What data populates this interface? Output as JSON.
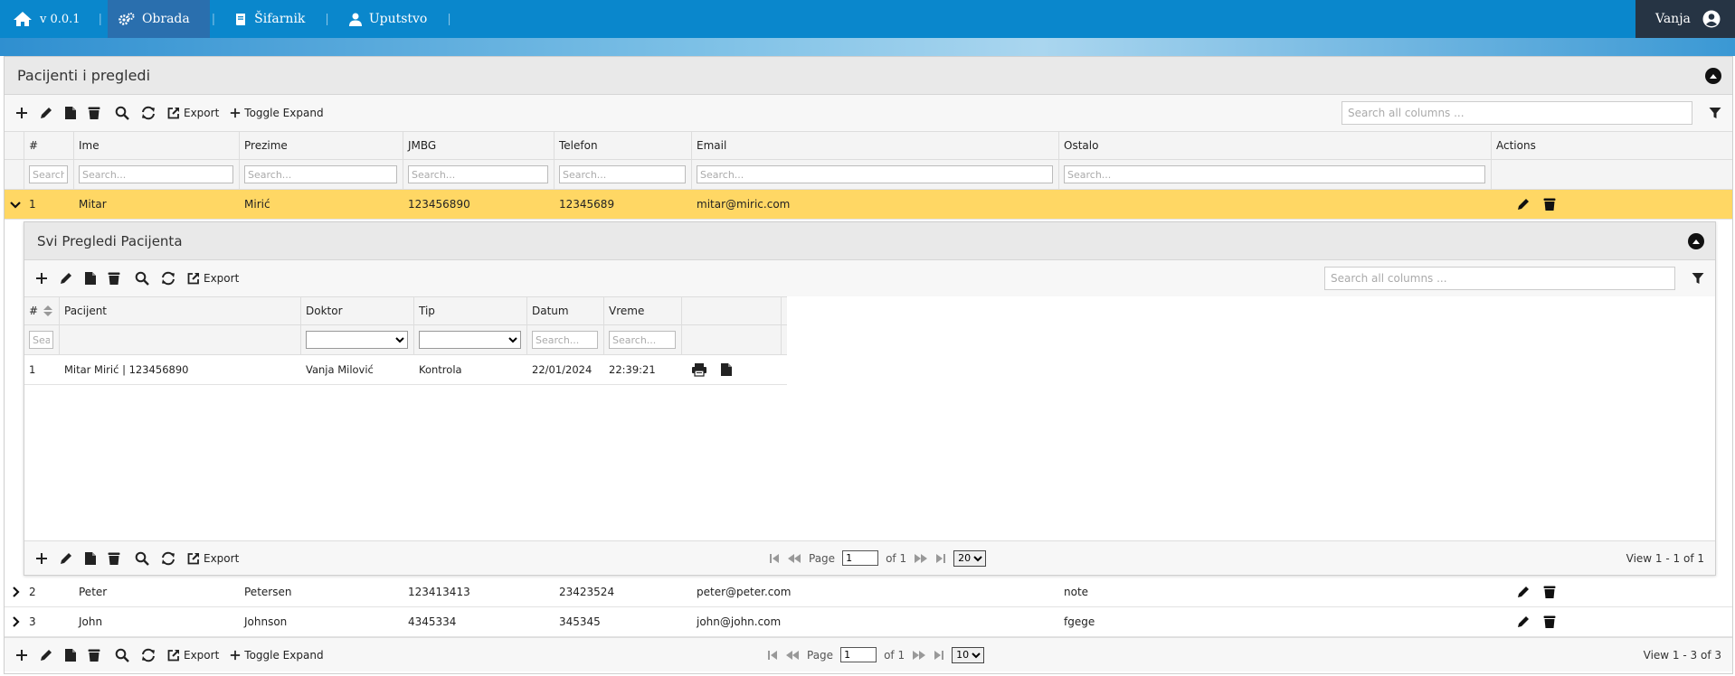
{
  "nav": {
    "version": "v 0.0.1",
    "items": [
      {
        "label": "Obrada"
      },
      {
        "label": "Šifarnik"
      },
      {
        "label": "Uputstvo"
      }
    ],
    "user": "Vanja"
  },
  "panel": {
    "title": "Pacijenti i pregledi",
    "toolbar": {
      "export_label": "Export",
      "toggle_label": "Toggle Expand"
    },
    "search_placeholder": "Search all columns ...",
    "columns": [
      "#",
      "Ime",
      "Prezime",
      "JMBG",
      "Telefon",
      "Email",
      "Ostalo",
      "Actions"
    ],
    "filter_placeholder": "Search...",
    "rows": [
      {
        "num": "1",
        "ime": "Mitar",
        "prezime": "Mirić",
        "jmbg": "123456890",
        "telefon": "12345689",
        "email": "mitar@miric.com",
        "ostalo": ""
      },
      {
        "num": "2",
        "ime": "Peter",
        "prezime": "Petersen",
        "jmbg": "123413413",
        "telefon": "23423524",
        "email": "peter@peter.com",
        "ostalo": "note"
      },
      {
        "num": "3",
        "ime": "John",
        "prezime": "Johnson",
        "jmbg": "4345334",
        "telefon": "345345",
        "email": "john@john.com",
        "ostalo": "fgege"
      }
    ],
    "pager": {
      "page_label": "Page",
      "page_value": "1",
      "of_label": "of 1",
      "page_size": "10",
      "view_text": "View 1 - 3 of 3"
    }
  },
  "subpanel": {
    "title": "Svi Pregledi Pacijenta",
    "toolbar": {
      "export_label": "Export"
    },
    "search_placeholder": "Search all columns ...",
    "columns": [
      "#",
      "Pacijent",
      "Doktor",
      "Tip",
      "Datum",
      "Vreme",
      ""
    ],
    "filter_placeholder_short": "Sea",
    "filter_placeholder": "Search...",
    "rows": [
      {
        "num": "1",
        "pacijent": "Mitar Mirić | 123456890",
        "doktor": "Vanja Milović",
        "tip": "Kontrola",
        "datum": "22/01/2024",
        "vreme": "22:39:21"
      }
    ],
    "pager": {
      "page_label": "Page",
      "page_value": "1",
      "of_label": "of 1",
      "page_size": "20",
      "view_text": "View 1 - 1 of 1"
    }
  }
}
